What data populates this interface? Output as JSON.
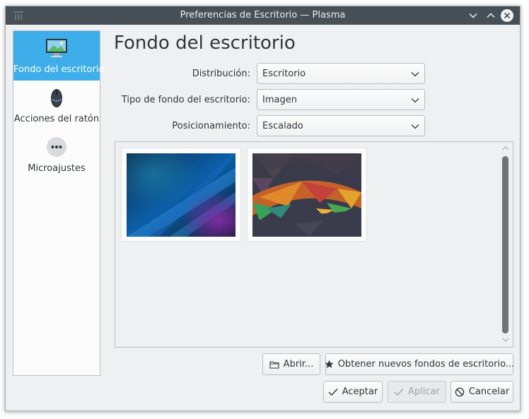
{
  "window": {
    "title": "Preferencias de Escritorio — Plasma"
  },
  "sidebar": {
    "items": [
      {
        "label": "Fondo del escritorio",
        "icon": "monitor-icon",
        "selected": true
      },
      {
        "label": "Acciones del ratón",
        "icon": "mouse-icon",
        "selected": false
      },
      {
        "label": "Microajustes",
        "icon": "more-options-icon",
        "selected": false
      }
    ]
  },
  "main": {
    "title": "Fondo del escritorio",
    "fields": [
      {
        "label": "Distribución:",
        "value": "Escritorio"
      },
      {
        "label": "Tipo de fondo del escritorio:",
        "value": "Imagen"
      },
      {
        "label": "Posicionamiento:",
        "value": "Escalado"
      }
    ],
    "wallpapers": [
      {
        "name": "blue-curves-wallpaper"
      },
      {
        "name": "polygon-wallpaper"
      }
    ]
  },
  "buttons": {
    "open": "Abrir...",
    "get_new": "Obtener nuevos fondos de escritorio...",
    "ok": "Aceptar",
    "apply": "Aplicar",
    "cancel": "Cancelar"
  },
  "colors": {
    "accent": "#3daee9",
    "titlebar": "#475057",
    "window_bg": "#eff0f1"
  }
}
